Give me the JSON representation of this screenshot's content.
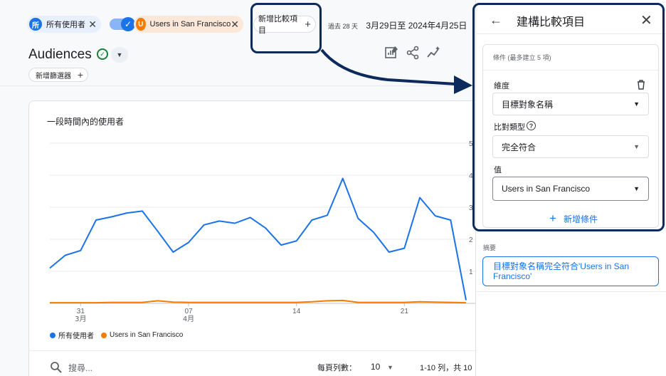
{
  "chips": {
    "all_users": {
      "avatar": "所",
      "label": "所有使用者"
    },
    "sf": {
      "avatar": "U",
      "label": "Users in San Francisco"
    },
    "add_comparison": "新增比較項目"
  },
  "date_range": {
    "prefix": "過去 28 天",
    "value": "3月29日至 2024年4月25日"
  },
  "page": {
    "title": "Audiences",
    "add_filter": "新增篩選器"
  },
  "card": {
    "title": "一段時間內的使用者",
    "search_placeholder": "搜尋...",
    "rows_per_page_label": "每頁列數：",
    "rows_per_page_value": "10",
    "pager": "1-10 列，共 10"
  },
  "chart_data": {
    "type": "line",
    "x_tick_labels": [
      {
        "day": "31",
        "month": "3月"
      },
      {
        "day": "07",
        "month": "4月"
      },
      {
        "day": "14",
        "month": ""
      },
      {
        "day": "21",
        "month": ""
      }
    ],
    "y_tick_labels_partial": [
      "5",
      "4",
      "3",
      "2",
      "1"
    ],
    "series": [
      {
        "name": "所有使用者",
        "color": "#1a73e8",
        "values": [
          1.1,
          1.5,
          1.65,
          2.6,
          2.7,
          2.82,
          2.88,
          2.25,
          1.6,
          1.9,
          2.45,
          2.57,
          2.5,
          2.68,
          2.35,
          1.82,
          1.95,
          2.6,
          2.75,
          3.9,
          2.65,
          2.22,
          1.6,
          1.72,
          3.3,
          2.73,
          2.6,
          0.1
        ]
      },
      {
        "name": "Users in San Francisco",
        "color": "#f57c00",
        "values": [
          0.02,
          0.02,
          0.02,
          0.02,
          0.03,
          0.03,
          0.03,
          0.08,
          0.04,
          0.03,
          0.03,
          0.03,
          0.03,
          0.03,
          0.03,
          0.03,
          0.03,
          0.05,
          0.08,
          0.09,
          0.03,
          0.03,
          0.03,
          0.03,
          0.05,
          0.04,
          0.03,
          0.02
        ]
      }
    ],
    "ylim": [
      0,
      5
    ]
  },
  "panel": {
    "title": "建構比較項目",
    "conditions_label": "條件 (最多建立 5 項)",
    "dimension_label": "維度",
    "dimension_value": "目標對象名稱",
    "match_type_label": "比對類型",
    "match_type_value": "完全符合",
    "value_label": "值",
    "value_value": "Users in San Francisco",
    "add_condition": "新增條件",
    "summary_label": "摘要",
    "summary_text": "目標對象名稱完全符合'Users in San Francisco'"
  }
}
